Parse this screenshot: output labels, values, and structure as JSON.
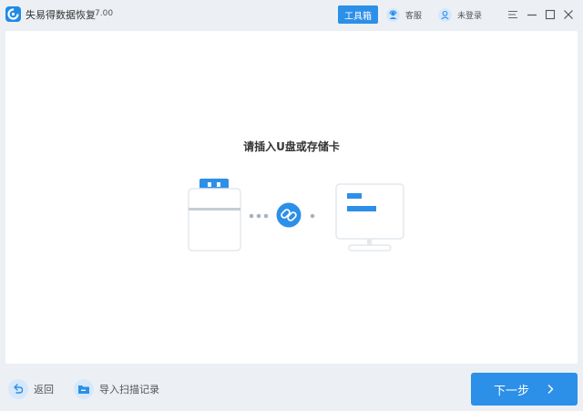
{
  "titlebar": {
    "app_name": "失易得数据恢复",
    "version": "7.00",
    "toolbox_label": "工具箱",
    "service_label": "客服",
    "login_label": "未登录"
  },
  "main": {
    "prompt": "请插入U盘或存储卡"
  },
  "footer": {
    "back_label": "返回",
    "import_label": "导入扫描记录",
    "next_label": "下一步"
  },
  "colors": {
    "accent": "#2C8FE8",
    "background": "#ECF0F5",
    "panel": "#FFFFFF"
  },
  "icons": [
    "app-logo-icon",
    "headset-icon",
    "user-icon",
    "menu-icon",
    "minimize-icon",
    "maximize-icon",
    "close-icon",
    "usb-drive-icon",
    "link-icon",
    "monitor-icon",
    "back-arrow-icon",
    "folder-import-icon",
    "chevron-right-icon"
  ]
}
